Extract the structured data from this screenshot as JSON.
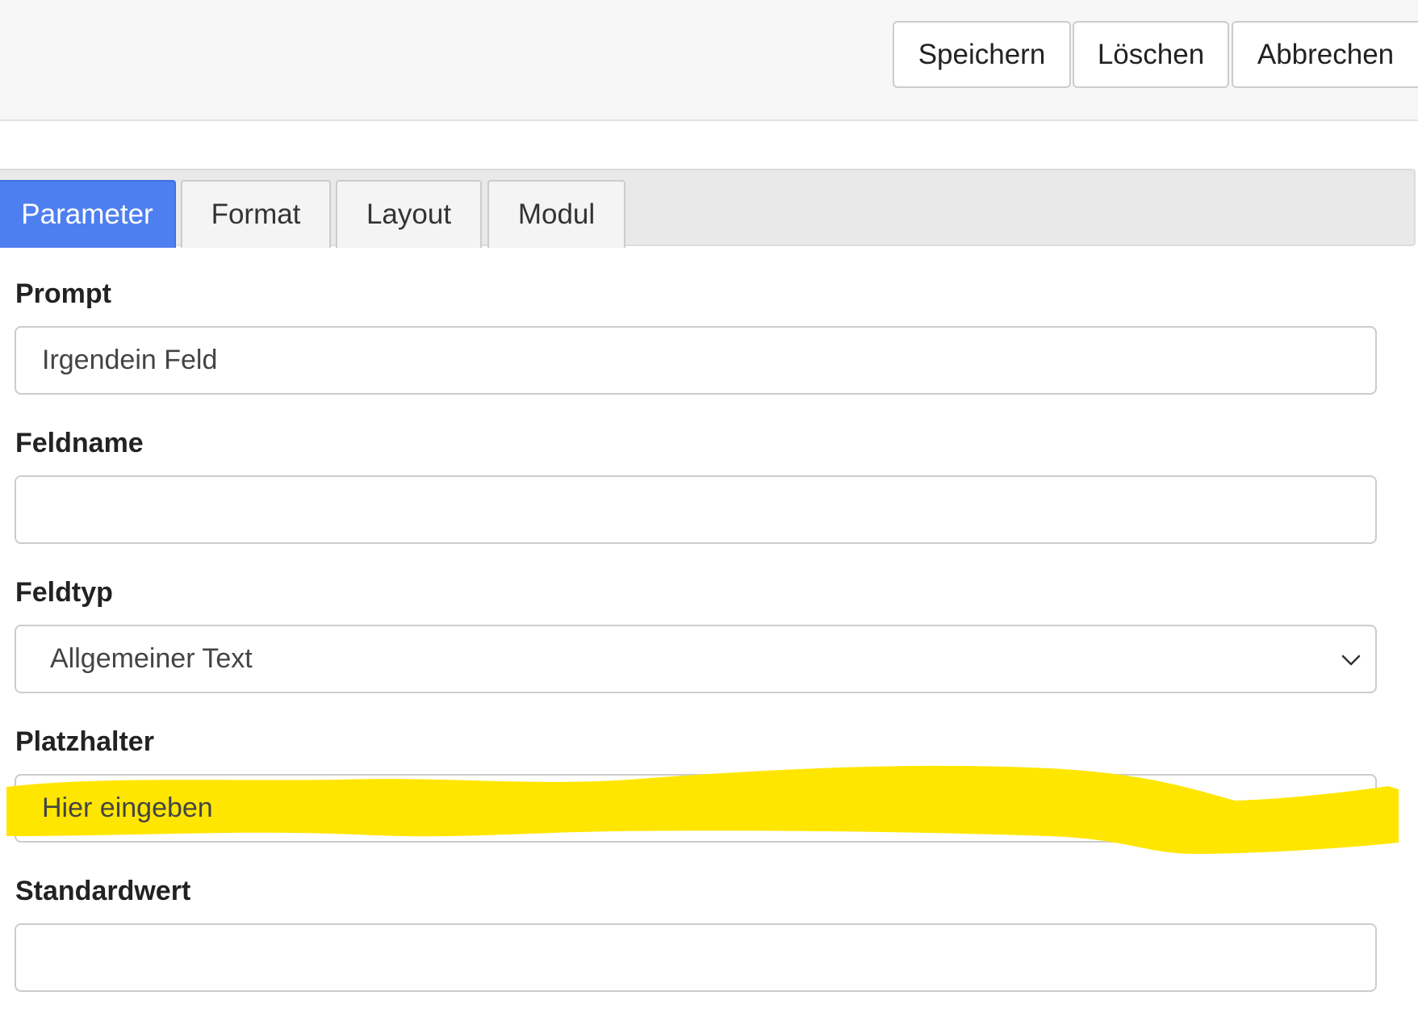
{
  "toolbar": {
    "save_label": "Speichern",
    "delete_label": "Löschen",
    "cancel_label": "Abbrechen"
  },
  "tabs": [
    {
      "label": "Parameter",
      "active": true
    },
    {
      "label": "Format",
      "active": false
    },
    {
      "label": "Layout",
      "active": false
    },
    {
      "label": "Modul",
      "active": false
    }
  ],
  "form": {
    "prompt": {
      "label": "Prompt",
      "value": "Irgendein Feld"
    },
    "feldname": {
      "label": "Feldname",
      "value": ""
    },
    "feldtyp": {
      "label": "Feldtyp",
      "value": "Allgemeiner Text"
    },
    "platzhalter": {
      "label": "Platzhalter",
      "value": "Hier eingeben"
    },
    "standardwert": {
      "label": "Standardwert",
      "value": ""
    }
  },
  "colors": {
    "active_tab": "#4e7ff0",
    "highlight": "#ffe600"
  },
  "icons": {
    "select_arrow": "chevron-down-icon"
  }
}
